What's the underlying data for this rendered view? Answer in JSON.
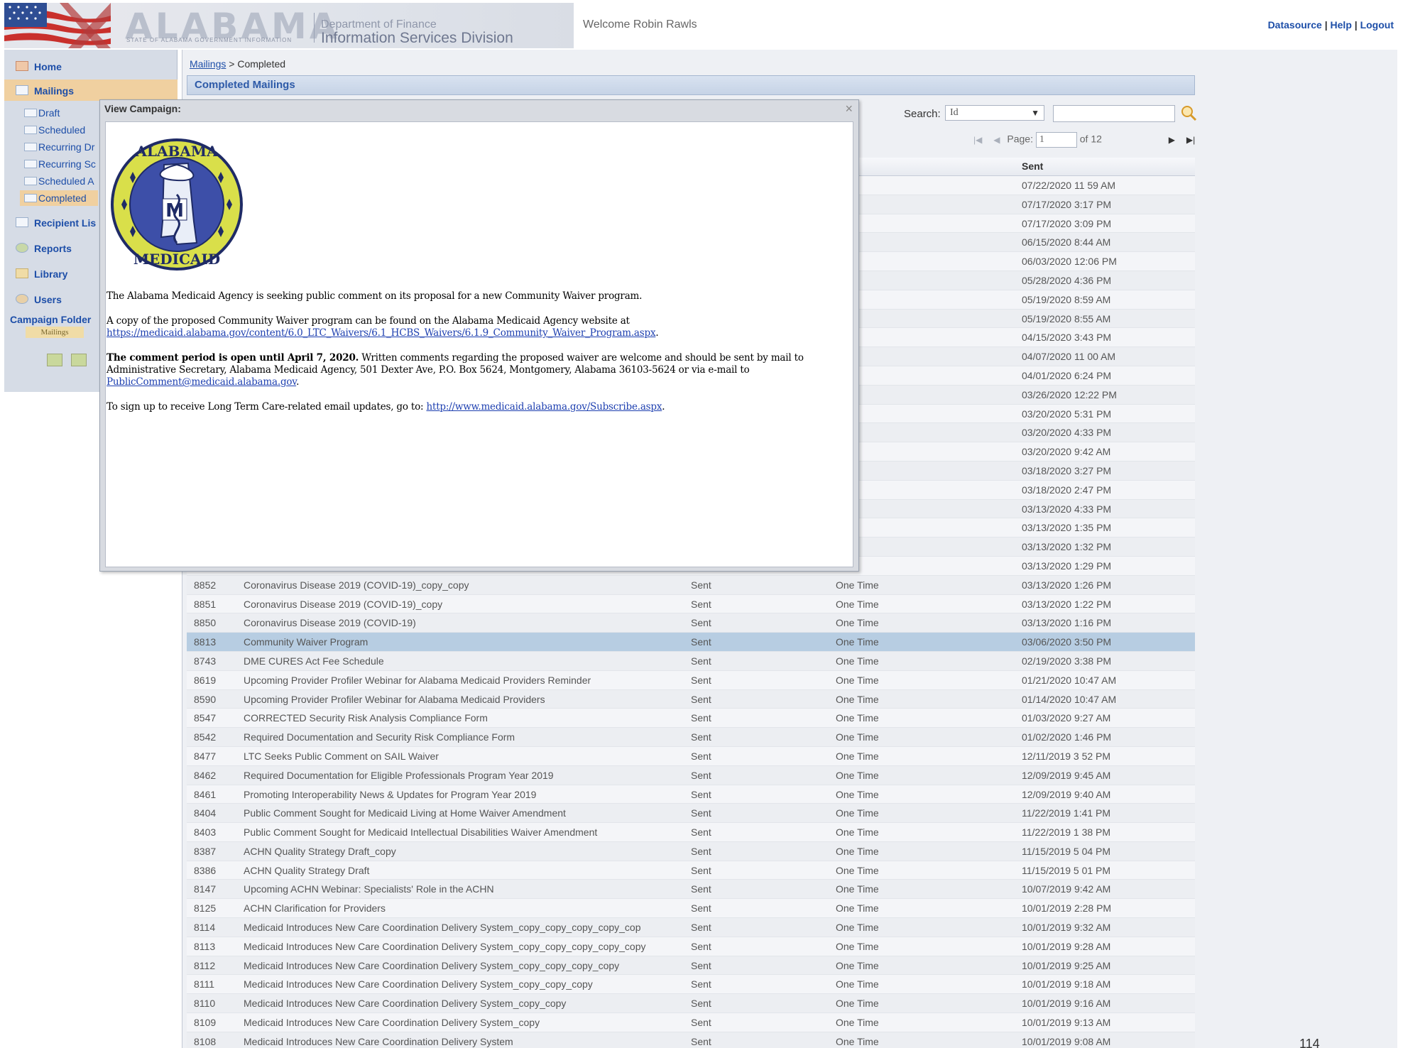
{
  "header": {
    "logo_word": "ALABAMA",
    "logo_sub": "STATE OF ALABAMA GOVERNMENT INFORMATION",
    "dept_line1": "Department of Finance",
    "dept_line2": "Information Services Division",
    "welcome": "Welcome Robin Rawls",
    "links": [
      "Datasource",
      "Help",
      "Logout"
    ]
  },
  "sidebar": {
    "items": [
      {
        "label": "Home"
      },
      {
        "label": "Mailings"
      },
      {
        "label": "Recipient Lis"
      },
      {
        "label": "Reports"
      },
      {
        "label": "Library"
      },
      {
        "label": "Users"
      }
    ],
    "mailing_subs": [
      "Draft",
      "Scheduled",
      "Recurring Dr",
      "Recurring Sc",
      "Scheduled A",
      "Completed"
    ],
    "campaign_folder": "Campaign Folder",
    "mailings_tag": "Mailings"
  },
  "main": {
    "breadcrumb_link": "Mailings",
    "breadcrumb_sep": " > ",
    "breadcrumb_current": "Completed",
    "panel_title": "Completed Mailings",
    "search_label": "Search:",
    "search_field": "Id",
    "page_label": "Page:",
    "page_value": "1",
    "page_of": "of 12",
    "column_sent": "Sent",
    "page_number": "114"
  },
  "rows": [
    {
      "id": "",
      "name": "",
      "status": "",
      "type": "me",
      "sent": "07/22/2020 11 59 AM"
    },
    {
      "id": "",
      "name": "",
      "status": "",
      "type": "me",
      "sent": "07/17/2020 3:17 PM"
    },
    {
      "id": "",
      "name": "",
      "status": "",
      "type": "me",
      "sent": "07/17/2020 3:09 PM"
    },
    {
      "id": "",
      "name": "",
      "status": "",
      "type": "me",
      "sent": "06/15/2020 8:44 AM"
    },
    {
      "id": "",
      "name": "",
      "status": "",
      "type": "me",
      "sent": "06/03/2020 12:06 PM"
    },
    {
      "id": "",
      "name": "",
      "status": "",
      "type": "me",
      "sent": "05/28/2020 4:36 PM"
    },
    {
      "id": "",
      "name": "",
      "status": "",
      "type": "me",
      "sent": "05/19/2020 8:59 AM"
    },
    {
      "id": "",
      "name": "",
      "status": "",
      "type": "me",
      "sent": "05/19/2020 8:55 AM"
    },
    {
      "id": "",
      "name": "",
      "status": "",
      "type": "me",
      "sent": "04/15/2020 3:43 PM"
    },
    {
      "id": "",
      "name": "",
      "status": "",
      "type": "me",
      "sent": "04/07/2020 11 00 AM"
    },
    {
      "id": "",
      "name": "",
      "status": "",
      "type": "me",
      "sent": "04/01/2020 6:24 PM"
    },
    {
      "id": "",
      "name": "",
      "status": "",
      "type": "me",
      "sent": "03/26/2020 12:22 PM"
    },
    {
      "id": "",
      "name": "",
      "status": "",
      "type": "me",
      "sent": "03/20/2020 5:31 PM"
    },
    {
      "id": "",
      "name": "",
      "status": "",
      "type": "me",
      "sent": "03/20/2020 4:33 PM"
    },
    {
      "id": "",
      "name": "",
      "status": "",
      "type": "me",
      "sent": "03/20/2020 9:42 AM"
    },
    {
      "id": "",
      "name": "",
      "status": "",
      "type": "me",
      "sent": "03/18/2020 3:27 PM"
    },
    {
      "id": "",
      "name": "",
      "status": "",
      "type": "me",
      "sent": "03/18/2020 2:47 PM"
    },
    {
      "id": "",
      "name": "",
      "status": "",
      "type": "me",
      "sent": "03/13/2020 4:33 PM"
    },
    {
      "id": "",
      "name": "",
      "status": "",
      "type": "me",
      "sent": "03/13/2020 1:35 PM"
    },
    {
      "id": "",
      "name": "",
      "status": "",
      "type": "me",
      "sent": "03/13/2020 1:32 PM"
    },
    {
      "id": "",
      "name": "",
      "status": "",
      "type": "me",
      "sent": "03/13/2020 1:29 PM"
    },
    {
      "id": "8852",
      "name": "Coronavirus Disease 2019 (COVID-19)_copy_copy",
      "status": "Sent",
      "type": "One Time",
      "sent": "03/13/2020 1:26 PM"
    },
    {
      "id": "8851",
      "name": "Coronavirus Disease 2019 (COVID-19)_copy",
      "status": "Sent",
      "type": "One Time",
      "sent": "03/13/2020 1:22 PM"
    },
    {
      "id": "8850",
      "name": "Coronavirus Disease 2019 (COVID-19)",
      "status": "Sent",
      "type": "One Time",
      "sent": "03/13/2020 1:16 PM"
    },
    {
      "id": "8813",
      "name": "Community Waiver Program",
      "status": "Sent",
      "type": "One Time",
      "sent": "03/06/2020 3:50 PM",
      "selected": true
    },
    {
      "id": "8743",
      "name": "DME CURES Act Fee Schedule",
      "status": "Sent",
      "type": "One Time",
      "sent": "02/19/2020 3:38 PM"
    },
    {
      "id": "8619",
      "name": "Upcoming Provider Profiler Webinar for Alabama Medicaid Providers Reminder",
      "status": "Sent",
      "type": "One Time",
      "sent": "01/21/2020 10:47 AM"
    },
    {
      "id": "8590",
      "name": "Upcoming Provider Profiler Webinar for Alabama Medicaid Providers",
      "status": "Sent",
      "type": "One Time",
      "sent": "01/14/2020 10:47 AM"
    },
    {
      "id": "8547",
      "name": "CORRECTED Security Risk Analysis Compliance Form",
      "status": "Sent",
      "type": "One Time",
      "sent": "01/03/2020 9:27 AM"
    },
    {
      "id": "8542",
      "name": "Required Documentation and Security Risk Compliance Form",
      "status": "Sent",
      "type": "One Time",
      "sent": "01/02/2020 1:46 PM"
    },
    {
      "id": "8477",
      "name": "LTC Seeks Public Comment on SAIL Waiver",
      "status": "Sent",
      "type": "One Time",
      "sent": "12/11/2019 3 52 PM"
    },
    {
      "id": "8462",
      "name": "Required Documentation for Eligible Professionals Program Year 2019",
      "status": "Sent",
      "type": "One Time",
      "sent": "12/09/2019 9:45 AM"
    },
    {
      "id": "8461",
      "name": "Promoting Interoperability News & Updates for Program Year 2019",
      "status": "Sent",
      "type": "One Time",
      "sent": "12/09/2019 9:40 AM"
    },
    {
      "id": "8404",
      "name": "Public Comment Sought for Medicaid Living at Home Waiver Amendment",
      "status": "Sent",
      "type": "One Time",
      "sent": "11/22/2019 1:41 PM"
    },
    {
      "id": "8403",
      "name": "Public Comment Sought for Medicaid Intellectual Disabilities Waiver Amendment",
      "status": "Sent",
      "type": "One Time",
      "sent": "11/22/2019 1 38 PM"
    },
    {
      "id": "8387",
      "name": "ACHN Quality Strategy Draft_copy",
      "status": "Sent",
      "type": "One Time",
      "sent": "11/15/2019 5 04 PM"
    },
    {
      "id": "8386",
      "name": "ACHN Quality Strategy Draft",
      "status": "Sent",
      "type": "One Time",
      "sent": "11/15/2019 5 01 PM"
    },
    {
      "id": "8147",
      "name": "Upcoming ACHN Webinar: Specialists' Role in the ACHN",
      "status": "Sent",
      "type": "One Time",
      "sent": "10/07/2019 9:42 AM"
    },
    {
      "id": "8125",
      "name": "ACHN Clarification for Providers",
      "status": "Sent",
      "type": "One Time",
      "sent": "10/01/2019 2:28 PM"
    },
    {
      "id": "8114",
      "name": "Medicaid Introduces New Care Coordination Delivery System_copy_copy_copy_copy_cop",
      "status": "Sent",
      "type": "One Time",
      "sent": "10/01/2019 9:32 AM"
    },
    {
      "id": "8113",
      "name": "Medicaid Introduces New Care Coordination Delivery System_copy_copy_copy_copy_copy",
      "status": "Sent",
      "type": "One Time",
      "sent": "10/01/2019 9:28 AM"
    },
    {
      "id": "8112",
      "name": "Medicaid Introduces New Care Coordination Delivery System_copy_copy_copy_copy",
      "status": "Sent",
      "type": "One Time",
      "sent": "10/01/2019 9:25 AM"
    },
    {
      "id": "8111",
      "name": "Medicaid Introduces New Care Coordination Delivery System_copy_copy_copy",
      "status": "Sent",
      "type": "One Time",
      "sent": "10/01/2019 9:18 AM"
    },
    {
      "id": "8110",
      "name": "Medicaid Introduces New Care Coordination Delivery System_copy_copy",
      "status": "Sent",
      "type": "One Time",
      "sent": "10/01/2019 9:16 AM"
    },
    {
      "id": "8109",
      "name": "Medicaid Introduces New Care Coordination Delivery System_copy",
      "status": "Sent",
      "type": "One Time",
      "sent": "10/01/2019 9:13 AM"
    },
    {
      "id": "8108",
      "name": "Medicaid Introduces New Care Coordination Delivery System",
      "status": "Sent",
      "type": "One Time",
      "sent": "10/01/2019 9:08 AM"
    }
  ],
  "modal": {
    "title": "View Campaign:",
    "close": "×",
    "seal_text_top": "ALABAMA",
    "seal_text_bottom": "MEDICAID",
    "seal_letter": "M",
    "p1": "The Alabama Medicaid Agency is seeking public comment on its proposal for a new Community Waiver program.",
    "p2a": "A copy of the proposed Community Waiver program can be found on the Alabama Medicaid Agency website at",
    "p2_link": "https://medicaid.alabama.gov/content/6.0_LTC_Waivers/6.1_HCBS_Waivers/6.1.9_Community_Waiver_Program.aspx",
    "p2_end": ".",
    "p3_bold": "The comment period is open until April 7, 2020.",
    "p3a": " Written comments regarding the proposed waiver are welcome and should be sent by mail to",
    "p3b": "Administrative Secretary, Alabama Medicaid Agency, 501 Dexter Ave,  P.O. Box 5624, Montgomery, Alabama 36103-5624 or via e-mail to",
    "p3_link": "PublicComment@medicaid.alabama.gov",
    "p3_end": ".",
    "p4": "To sign up to receive Long Term Care-related email updates, go to: ",
    "p4_link": "http://www.medicaid.alabama.gov/Subscribe.aspx",
    "p4_end": "."
  },
  "colors": {
    "link": "#1d4ea8",
    "sidebar_bg": "#d6dce6",
    "active_item": "#f0d0a0",
    "selected_row": "#b7cde2",
    "panel_title": "#2d5aa8"
  }
}
